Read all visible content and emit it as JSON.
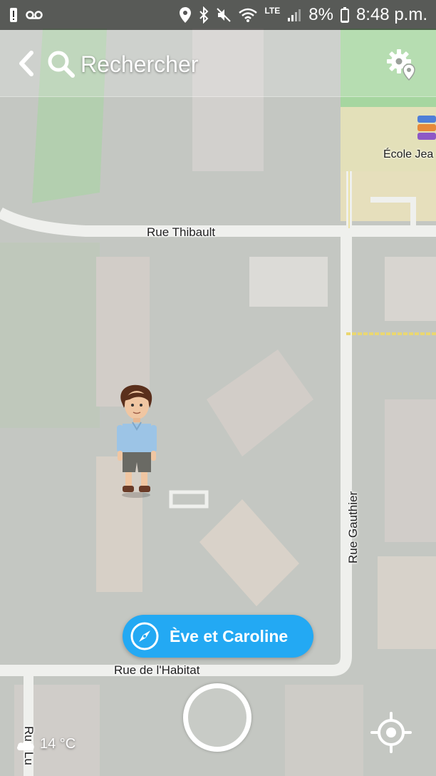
{
  "status_bar": {
    "lte": "LTE",
    "battery": "8%",
    "time": "8:48 p.m.",
    "icons": [
      "alert-icon",
      "voicemail-icon",
      "location-pin-icon",
      "bluetooth-icon",
      "mute-icon",
      "wifi-icon",
      "signal-icon",
      "battery-icon"
    ]
  },
  "header": {
    "search_label": "Rechercher",
    "back_icon": "chevron-left-icon",
    "search_icon": "search-icon",
    "settings_icon": "gear-location-icon"
  },
  "map": {
    "streets": {
      "thibault": "Rue Thibault",
      "gauthier": "Rue Gauthier",
      "habitat": "Rue de l'Habitat",
      "lu": "Rue Lu"
    },
    "poi": {
      "school": "École Jea"
    },
    "colors": {
      "road": "#e9ebe6",
      "park": "#8fcf86",
      "school_area": "#e6dbad",
      "ground": "#b9bcb6"
    }
  },
  "friend_pill": {
    "label": "Ève et Caroline",
    "icon": "compass-icon",
    "color": "#23a9f3"
  },
  "bottom": {
    "weather": "14 °C",
    "weather_icon": "cloud-icon",
    "capture_icon": "capture-ring-icon",
    "locate_icon": "crosshair-icon"
  }
}
